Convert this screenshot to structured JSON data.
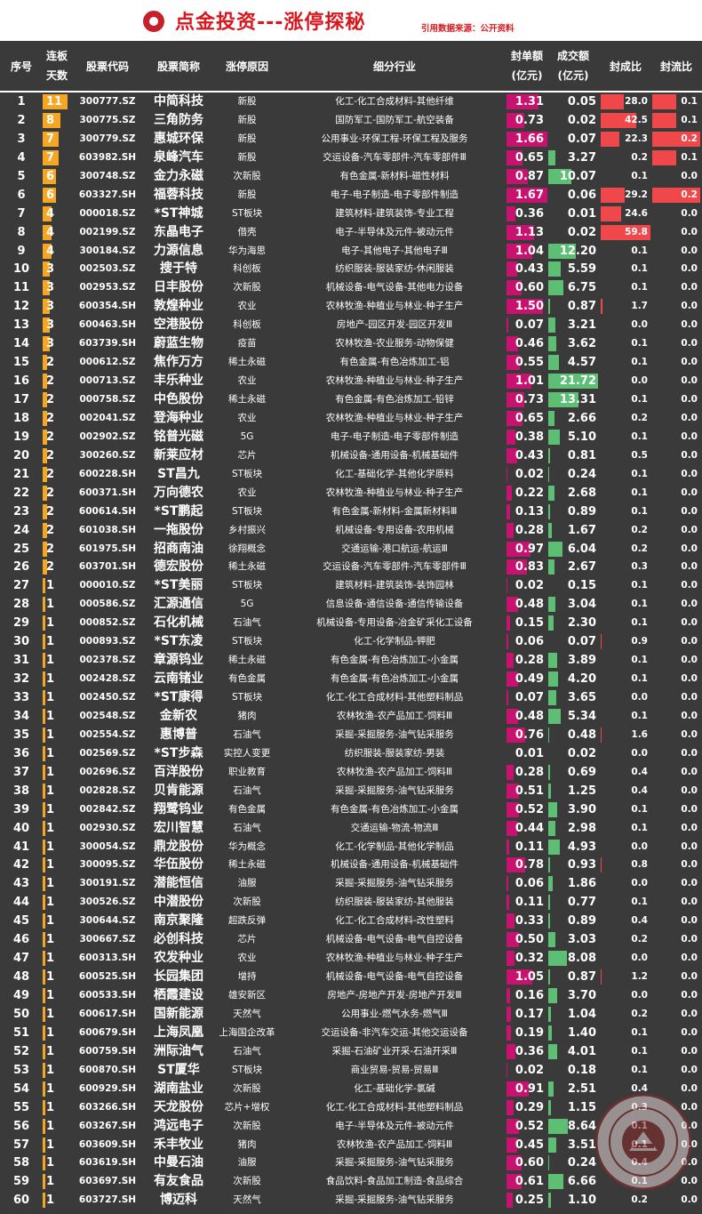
{
  "header": {
    "title": "点金投资---涨停探秘",
    "source": "引用数据来源：公开资料"
  },
  "columns": {
    "no": "序号",
    "days_l1": "连板",
    "days_l2": "天数",
    "code": "股票代码",
    "name": "股票简称",
    "reason": "涨停原因",
    "industry": "细分行业",
    "seal_l1": "封单额",
    "seal_l2": "(亿元)",
    "vol_l1": "成交额",
    "vol_l2": "(亿元)",
    "fcr": "封成比",
    "flr": "封流比"
  },
  "colors": {
    "days_bar": "#f5a623",
    "seal_bar": "#c8126f",
    "vol_bar": "#5cbf73",
    "ratio_bar": "#f0474b",
    "title": "#d7191f"
  },
  "stamp_text": "第一私募 SIMUWANG",
  "rows": [
    [
      "1",
      "11",
      "300777.SZ",
      "中简科技",
      "新股",
      "化工-化工合成材料-其他纤维",
      "1.31",
      "0.05",
      "28.0",
      "0.1"
    ],
    [
      "2",
      "8",
      "300775.SZ",
      "三角防务",
      "新股",
      "国防军工-国防军工-航空装备",
      "0.73",
      "0.02",
      "42.5",
      "0.1"
    ],
    [
      "3",
      "7",
      "300779.SZ",
      "惠城环保",
      "新股",
      "公用事业-环保工程-环保工程及服务",
      "1.66",
      "0.07",
      "22.3",
      "0.2"
    ],
    [
      "4",
      "7",
      "603982.SH",
      "泉峰汽车",
      "新股",
      "交运设备-汽车零部件-汽车零部件Ⅲ",
      "0.65",
      "3.27",
      "0.2",
      "0.1"
    ],
    [
      "5",
      "6",
      "300748.SZ",
      "金力永磁",
      "次新股",
      "有色金属-新材料-磁性材料",
      "0.87",
      "10.07",
      "0.1",
      "0.0"
    ],
    [
      "6",
      "6",
      "603327.SH",
      "福蓉科技",
      "新股",
      "电子-电子制造-电子零部件制造",
      "1.67",
      "0.06",
      "29.2",
      "0.2"
    ],
    [
      "7",
      "4",
      "000018.SZ",
      "*ST神城",
      "ST板块",
      "建筑材料-建筑装饰-专业工程",
      "0.36",
      "0.01",
      "24.6",
      "0.0"
    ],
    [
      "8",
      "4",
      "002199.SZ",
      "东晶电子",
      "借壳",
      "电子-半导体及元件-被动元件",
      "1.13",
      "0.02",
      "59.8",
      "0.0"
    ],
    [
      "9",
      "4",
      "300184.SZ",
      "力源信息",
      "华为海思",
      "电子-其他电子-其他电子Ⅲ",
      "1.04",
      "12.20",
      "0.1",
      "0.0"
    ],
    [
      "10",
      "3",
      "002503.SZ",
      "搜于特",
      "科创板",
      "纺织服装-服装家纺-休闲服装",
      "0.43",
      "5.59",
      "0.1",
      "0.0"
    ],
    [
      "11",
      "3",
      "002953.SZ",
      "日丰股份",
      "次新股",
      "机械设备-电气设备-其他电力设备",
      "0.60",
      "6.75",
      "0.1",
      "0.0"
    ],
    [
      "12",
      "3",
      "600354.SH",
      "敦煌种业",
      "农业",
      "农林牧渔-种植业与林业-种子生产",
      "1.50",
      "0.87",
      "1.7",
      "0.0"
    ],
    [
      "13",
      "3",
      "600463.SH",
      "空港股份",
      "科创板",
      "房地产-园区开发-园区开发Ⅲ",
      "0.07",
      "3.21",
      "0.0",
      "0.0"
    ],
    [
      "14",
      "3",
      "603739.SH",
      "蔚蓝生物",
      "疫苗",
      "农林牧渔-农业服务-动物保健",
      "0.46",
      "3.62",
      "0.1",
      "0.0"
    ],
    [
      "15",
      "2",
      "000612.SZ",
      "焦作万方",
      "稀土永磁",
      "有色金属-有色冶炼加工-铝",
      "0.55",
      "4.57",
      "0.1",
      "0.0"
    ],
    [
      "16",
      "2",
      "000713.SZ",
      "丰乐种业",
      "农业",
      "农林牧渔-种植业与林业-种子生产",
      "1.01",
      "21.72",
      "0.0",
      "0.0"
    ],
    [
      "17",
      "2",
      "000758.SZ",
      "中色股份",
      "稀土永磁",
      "有色金属-有色冶炼加工-铅锌",
      "0.73",
      "13.31",
      "0.1",
      "0.0"
    ],
    [
      "18",
      "2",
      "002041.SZ",
      "登海种业",
      "农业",
      "农林牧渔-种植业与林业-种子生产",
      "0.65",
      "2.66",
      "0.2",
      "0.0"
    ],
    [
      "19",
      "2",
      "002902.SZ",
      "铭普光磁",
      "5G",
      "电子-电子制造-电子零部件制造",
      "0.38",
      "5.10",
      "0.1",
      "0.0"
    ],
    [
      "20",
      "2",
      "300260.SZ",
      "新莱应材",
      "芯片",
      "机械设备-通用设备-机械基础件",
      "0.43",
      "0.81",
      "0.5",
      "0.0"
    ],
    [
      "21",
      "2",
      "600228.SH",
      "ST昌九",
      "ST板块",
      "化工-基础化学-其他化学原料",
      "0.02",
      "0.24",
      "0.1",
      "0.0"
    ],
    [
      "22",
      "2",
      "600371.SH",
      "万向德农",
      "农业",
      "农林牧渔-种植业与林业-种子生产",
      "0.22",
      "2.68",
      "0.1",
      "0.0"
    ],
    [
      "23",
      "2",
      "600614.SH",
      "*ST鹏起",
      "ST板块",
      "有色金属-新材料-金属新材料Ⅲ",
      "0.13",
      "0.89",
      "0.1",
      "0.0"
    ],
    [
      "24",
      "2",
      "601038.SH",
      "一拖股份",
      "乡村振兴",
      "机械设备-专用设备-农用机械",
      "0.28",
      "1.67",
      "0.2",
      "0.0"
    ],
    [
      "25",
      "2",
      "601975.SH",
      "招商南油",
      "徐翔概念",
      "交通运输-港口航运-航运Ⅲ",
      "0.97",
      "6.04",
      "0.2",
      "0.0"
    ],
    [
      "26",
      "2",
      "603701.SH",
      "德宏股份",
      "稀土永磁",
      "交运设备-汽车零部件-汽车零部件Ⅲ",
      "0.83",
      "2.67",
      "0.3",
      "0.0"
    ],
    [
      "27",
      "1",
      "000010.SZ",
      "*ST美丽",
      "ST板块",
      "建筑材料-建筑装饰-装饰园林",
      "0.02",
      "0.15",
      "0.1",
      "0.0"
    ],
    [
      "28",
      "1",
      "000586.SZ",
      "汇源通信",
      "5G",
      "信息设备-通信设备-通信传输设备",
      "0.48",
      "3.04",
      "0.1",
      "0.0"
    ],
    [
      "29",
      "1",
      "000852.SZ",
      "石化机械",
      "石油气",
      "机械设备-专用设备-冶金矿采化工设备",
      "0.15",
      "2.30",
      "0.1",
      "0.0"
    ],
    [
      "30",
      "1",
      "000893.SZ",
      "*ST东凌",
      "ST板块",
      "化工-化学制品-钾肥",
      "0.06",
      "0.07",
      "0.9",
      "0.0"
    ],
    [
      "31",
      "1",
      "002378.SZ",
      "章源钨业",
      "稀土永磁",
      "有色金属-有色冶炼加工-小金属",
      "0.28",
      "3.89",
      "0.1",
      "0.0"
    ],
    [
      "32",
      "1",
      "002428.SZ",
      "云南锗业",
      "有色金属",
      "有色金属-有色冶炼加工-小金属",
      "0.49",
      "4.20",
      "0.1",
      "0.0"
    ],
    [
      "33",
      "1",
      "002450.SZ",
      "*ST康得",
      "ST板块",
      "化工-化工合成材料-其他塑料制品",
      "0.07",
      "3.65",
      "0.0",
      "0.0"
    ],
    [
      "34",
      "1",
      "002548.SZ",
      "金新农",
      "猪肉",
      "农林牧渔-农产品加工-饲料Ⅲ",
      "0.48",
      "5.34",
      "0.1",
      "0.0"
    ],
    [
      "35",
      "1",
      "002554.SZ",
      "惠博普",
      "石油气",
      "采掘-采掘服务-油气钻采服务",
      "0.76",
      "0.48",
      "1.6",
      "0.0"
    ],
    [
      "36",
      "1",
      "002569.SZ",
      "*ST步森",
      "实控人变更",
      "纺织服装-服装家纺-男装",
      "0.01",
      "0.02",
      "0.0",
      "0.0"
    ],
    [
      "37",
      "1",
      "002696.SZ",
      "百洋股份",
      "职业教育",
      "农林牧渔-农产品加工-饲料Ⅲ",
      "0.28",
      "0.69",
      "0.4",
      "0.0"
    ],
    [
      "38",
      "1",
      "002828.SZ",
      "贝肯能源",
      "石油气",
      "采掘-采掘服务-油气钻采服务",
      "0.51",
      "1.25",
      "0.4",
      "0.0"
    ],
    [
      "39",
      "1",
      "002842.SZ",
      "翔鹭钨业",
      "有色金属",
      "有色金属-有色冶炼加工-小金属",
      "0.52",
      "3.90",
      "0.1",
      "0.0"
    ],
    [
      "40",
      "1",
      "002930.SZ",
      "宏川智慧",
      "石油气",
      "交通运输-物流-物流Ⅲ",
      "0.44",
      "2.98",
      "0.1",
      "0.0"
    ],
    [
      "41",
      "1",
      "300054.SZ",
      "鼎龙股份",
      "华为概念",
      "化工-化学制品-其他化学制品",
      "0.11",
      "4.93",
      "0.0",
      "0.0"
    ],
    [
      "42",
      "1",
      "300095.SZ",
      "华伍股份",
      "稀土永磁",
      "机械设备-通用设备-机械基础件",
      "0.78",
      "0.93",
      "0.8",
      "0.0"
    ],
    [
      "43",
      "1",
      "300191.SZ",
      "潜能恒信",
      "油服",
      "采掘-采掘服务-油气钻采服务",
      "0.06",
      "1.86",
      "0.0",
      "0.0"
    ],
    [
      "44",
      "1",
      "300526.SZ",
      "中潜股份",
      "次新股",
      "纺织服装-服装家纺-其他服装",
      "0.11",
      "0.77",
      "0.1",
      "0.0"
    ],
    [
      "45",
      "1",
      "300644.SZ",
      "南京聚隆",
      "超跌反弹",
      "化工-化工合成材料-改性塑料",
      "0.33",
      "0.89",
      "0.4",
      "0.0"
    ],
    [
      "46",
      "1",
      "300667.SZ",
      "必创科技",
      "芯片",
      "机械设备-电气设备-电气自控设备",
      "0.50",
      "3.03",
      "0.2",
      "0.0"
    ],
    [
      "47",
      "1",
      "600313.SH",
      "农发种业",
      "农业",
      "农林牧渔-种植业与林业-种子生产",
      "0.32",
      "8.08",
      "0.0",
      "0.0"
    ],
    [
      "48",
      "1",
      "600525.SH",
      "长园集团",
      "增持",
      "机械设备-电气设备-电气自控设备",
      "1.05",
      "0.87",
      "1.2",
      "0.0"
    ],
    [
      "49",
      "1",
      "600533.SH",
      "栖霞建设",
      "雄安新区",
      "房地产-房地产开发-房地产开发Ⅲ",
      "0.16",
      "3.70",
      "0.0",
      "0.0"
    ],
    [
      "50",
      "1",
      "600617.SH",
      "国新能源",
      "天然气",
      "公用事业-燃气水务-燃气Ⅲ",
      "0.17",
      "1.04",
      "0.2",
      "0.0"
    ],
    [
      "51",
      "1",
      "600679.SH",
      "上海凤凰",
      "上海国企改革",
      "交运设备-非汽车交运-其他交运设备",
      "0.19",
      "1.40",
      "0.1",
      "0.0"
    ],
    [
      "52",
      "1",
      "600759.SH",
      "洲际油气",
      "石油气",
      "采掘-石油矿业开采-石油开采Ⅲ",
      "0.36",
      "4.01",
      "0.1",
      "0.0"
    ],
    [
      "53",
      "1",
      "600870.SH",
      "ST厦华",
      "ST板块",
      "商业贸易-贸易-贸易Ⅲ",
      "0.02",
      "0.18",
      "0.1",
      "0.0"
    ],
    [
      "54",
      "1",
      "600929.SH",
      "湖南盐业",
      "次新股",
      "化工-基础化学-氯碱",
      "0.91",
      "2.51",
      "0.4",
      "0.0"
    ],
    [
      "55",
      "1",
      "603266.SH",
      "天龙股份",
      "芯片+增权",
      "化工-化工合成材料-其他塑料制品",
      "0.29",
      "1.15",
      "0.3",
      "0.0"
    ],
    [
      "56",
      "1",
      "603267.SH",
      "鸿远电子",
      "次新股",
      "电子-半导体及元件-被动元件",
      "0.52",
      "8.64",
      "0.1",
      "0.0"
    ],
    [
      "57",
      "1",
      "603609.SH",
      "禾丰牧业",
      "猪肉",
      "农林牧渔-农产品加工-饲料Ⅲ",
      "0.45",
      "3.51",
      "0.1",
      "0.0"
    ],
    [
      "58",
      "1",
      "603619.SH",
      "中曼石油",
      "油服",
      "采掘-采掘服务-油气钻采服务",
      "0.60",
      "0.24",
      "0.4",
      "0.0"
    ],
    [
      "59",
      "1",
      "603697.SH",
      "有友食品",
      "次新股",
      "食品饮料-食品加工制造-食品综合",
      "0.61",
      "6.66",
      "0.1",
      "0.0"
    ],
    [
      "60",
      "1",
      "603727.SH",
      "博迈科",
      "天然气",
      "采掘-采掘服务-油气钻采服务",
      "0.25",
      "1.10",
      "0.2",
      "0.0"
    ]
  ]
}
